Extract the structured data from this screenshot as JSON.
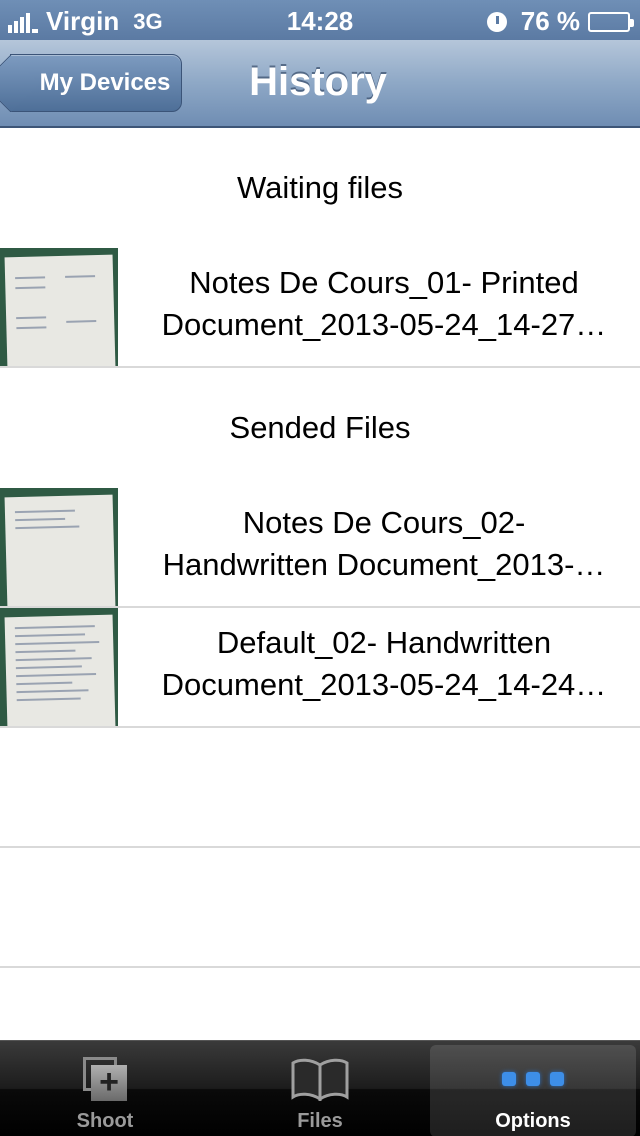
{
  "status_bar": {
    "carrier": "Virgin",
    "network": "3G",
    "time": "14:28",
    "battery": "76 %",
    "battery_level": 0.76,
    "icons": [
      "signal-icon",
      "alarm-icon",
      "battery-icon"
    ]
  },
  "nav": {
    "back_label": "My Devices",
    "title": "History"
  },
  "sections": {
    "waiting_header": "Waiting files",
    "sended_header": "Sended Files"
  },
  "waiting_files": [
    {
      "line1": "Notes De Cours_01- Printed",
      "line2": "Document_2013-05-24_14-27…"
    }
  ],
  "sended_files": [
    {
      "line1": "Notes De Cours_02-",
      "line2": "Handwritten Document_2013-…"
    },
    {
      "line1": "Default_02- Handwritten",
      "line2": "Document_2013-05-24_14-24…"
    }
  ],
  "tabs": [
    {
      "label": "Shoot",
      "icon": "shoot-icon"
    },
    {
      "label": "Files",
      "icon": "book-icon"
    },
    {
      "label": "Options",
      "icon": "more-icon",
      "active": true
    }
  ],
  "colors": {
    "status_bar": "#5b7aa3",
    "nav_bar": "#8ea8c6",
    "tab_active_dots": "#3d8ee8"
  }
}
